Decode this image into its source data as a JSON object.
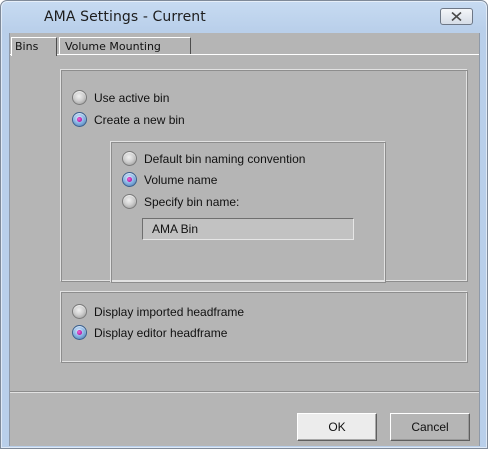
{
  "window": {
    "title": "AMA Settings - Current",
    "close_icon": "close-x-icon"
  },
  "tabs": [
    {
      "label": "Bins",
      "active": true
    },
    {
      "label": "Volume Mounting",
      "active": false
    }
  ],
  "bin_options": {
    "use_active_bin": {
      "label": "Use active bin",
      "checked": false
    },
    "create_new_bin": {
      "label": "Create a new bin",
      "checked": true
    },
    "naming": {
      "default_convention": {
        "label": "Default bin naming convention",
        "checked": false
      },
      "volume_name": {
        "label": "Volume name",
        "checked": true
      },
      "specify_name": {
        "label": "Specify bin name:",
        "checked": false
      },
      "bin_name_value": "AMA Bin"
    }
  },
  "headframe": {
    "imported": {
      "label": "Display imported headframe",
      "checked": false
    },
    "editor": {
      "label": "Display editor headframe",
      "checked": true
    }
  },
  "buttons": {
    "ok": "OK",
    "cancel": "Cancel"
  },
  "colors": {
    "dialog_bg": "#b5b5b5",
    "title_bar": "#b9cfea",
    "radio_selected_dot": "#b3169e"
  }
}
